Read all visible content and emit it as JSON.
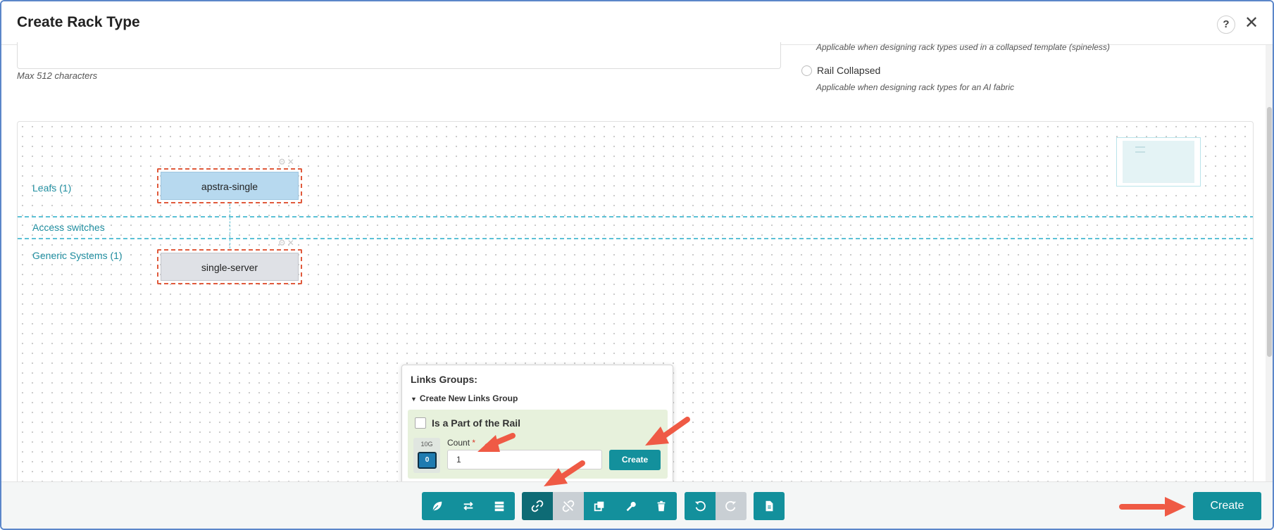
{
  "header": {
    "title": "Create Rack Type",
    "help_label": "?",
    "close_label": "✕"
  },
  "form": {
    "max_chars_hint": "Max 512 characters",
    "collapsed_help": "Applicable when designing rack types used in a collapsed template (spineless)",
    "rail_collapsed_label": "Rail Collapsed",
    "rail_collapsed_help": "Applicable when designing rack types for an AI fabric"
  },
  "canvas": {
    "rows": [
      {
        "label": "Leafs (1)"
      },
      {
        "label": "Access switches"
      },
      {
        "label": "Generic Systems (1)"
      }
    ],
    "nodes": {
      "leaf": "apstra-single",
      "generic": "single-server"
    },
    "node_icons": "⚙✕"
  },
  "links_popover": {
    "title": "Links Groups:",
    "subtitle": "Create New Links Group",
    "rail_checkbox_label": "Is a Part of the Rail",
    "speed_label": "10G",
    "port_count": "0",
    "count_label": "Count",
    "count_required": "*",
    "count_value": "1",
    "create_label": "Create"
  },
  "toolbar": {
    "icons": {
      "leaf": "leaf-icon",
      "swap": "swap-icon",
      "server": "server-icon",
      "link": "link-icon",
      "unlink": "unlink-icon",
      "copy": "copy-icon",
      "wrench": "wrench-icon",
      "trash": "trash-icon",
      "undo": "undo-icon",
      "redo": "redo-icon",
      "document": "document-icon"
    },
    "create_label": "Create"
  },
  "colors": {
    "accent": "#13909c",
    "accent_active": "#0e6b75",
    "annotation_arrow": "#ef5a45",
    "node_outline": "#e05a3c",
    "row_label": "#1f8ea0"
  }
}
